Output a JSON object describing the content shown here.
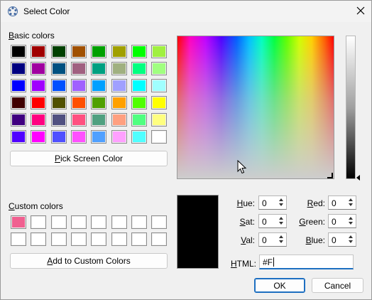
{
  "window": {
    "title": "Select Color",
    "icon": "color-picker-icon",
    "close_icon": "close-icon"
  },
  "basic_colors": {
    "label": "Basic colors",
    "label_underline": "B",
    "label_rest": "asic colors",
    "swatches": [
      "#000000",
      "#a00000",
      "#004000",
      "#a05000",
      "#00a000",
      "#a0a000",
      "#00ff00",
      "#a0f040",
      "#000080",
      "#a000a0",
      "#005080",
      "#a06080",
      "#00a080",
      "#a0b080",
      "#00ff80",
      "#a0ff80",
      "#0000ff",
      "#a000ff",
      "#0050ff",
      "#a060ff",
      "#00a0ff",
      "#a0a0ff",
      "#00ffff",
      "#a0ffff",
      "#400000",
      "#ff0000",
      "#505000",
      "#ff5000",
      "#50a000",
      "#ffa000",
      "#50ff00",
      "#ffff00",
      "#400080",
      "#ff0080",
      "#505080",
      "#ff5080",
      "#50a080",
      "#ffa080",
      "#50ff80",
      "#ffff80",
      "#5000ff",
      "#ff00ff",
      "#5050ff",
      "#ff50ff",
      "#50a0ff",
      "#ffa0ff",
      "#50ffff",
      "#ffffff"
    ]
  },
  "pick_screen_button": {
    "label_underline": "P",
    "label_rest": "ick Screen Color"
  },
  "custom_colors": {
    "label_underline": "C",
    "label_rest": "ustom colors",
    "swatches": [
      "#f06090",
      "#ffffff",
      "#ffffff",
      "#ffffff",
      "#ffffff",
      "#ffffff",
      "#ffffff",
      "#ffffff",
      "#ffffff",
      "#ffffff",
      "#ffffff",
      "#ffffff",
      "#ffffff",
      "#ffffff",
      "#ffffff",
      "#ffffff"
    ]
  },
  "add_custom_button": {
    "label_underline": "A",
    "label_rest": "dd to Custom Colors"
  },
  "preview_color": "#000000",
  "fields": {
    "hue": {
      "label_underline": "H",
      "label_rest": "ue:",
      "value": "0"
    },
    "sat": {
      "label_underline": "S",
      "label_rest": "at:",
      "value": "0"
    },
    "val": {
      "label_underline": "V",
      "label_rest": "al:",
      "value": "0"
    },
    "red": {
      "label_underline": "R",
      "label_rest": "ed:",
      "value": "0"
    },
    "green": {
      "label_underline": "G",
      "label_rest": "reen:",
      "value": "0"
    },
    "blue": {
      "label_underline": "B",
      "label_rest": "lue:",
      "value": "0"
    }
  },
  "html_field": {
    "label_underline": "H",
    "label_rest": "TML:",
    "value": "#F"
  },
  "ok_button": {
    "label": "OK"
  },
  "cancel_button": {
    "label": "Cancel"
  },
  "colors": {
    "accent": "#1d6fc1"
  }
}
